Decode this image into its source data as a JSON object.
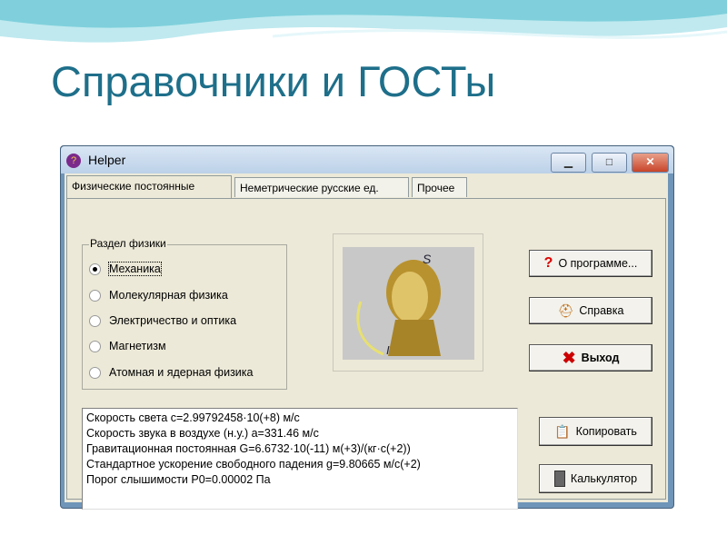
{
  "slide": {
    "title": "Справочники и ГОСТы"
  },
  "window": {
    "title": "Helper",
    "minimize": "▁",
    "maximize": "□",
    "close": "✕"
  },
  "tabs": [
    {
      "label": "Физические постоянные"
    },
    {
      "label": "Неметрические русские ед."
    },
    {
      "label": "Прочее"
    }
  ],
  "group": {
    "label": "Раздел физики",
    "options": [
      {
        "label": "Механика",
        "selected": true
      },
      {
        "label": "Молекулярная физика",
        "selected": false
      },
      {
        "label": "Электричество и оптика",
        "selected": false
      },
      {
        "label": "Магнетизм",
        "selected": false
      },
      {
        "label": "Атомная и ядерная физика",
        "selected": false
      }
    ]
  },
  "buttons": {
    "about": "О программе...",
    "help": "Справка",
    "exit": "Выход",
    "copy": "Копировать",
    "calc": "Калькулятор"
  },
  "memo": {
    "lines": [
      "Скорость света  c=2.99792458·10(+8) м/с",
      "Скорость звука в воздухе (н.у.)  a=331.46 м/с",
      "Гравитационная постоянная  G=6.6732·10(-11) м(+3)/(кг·с(+2))",
      "Стандартное ускорение свободного падения  g=9.80665 м/с(+2)",
      "Порог слышимости  P0=0.00002 Па"
    ]
  },
  "colors": {
    "title": "#1e6f8a",
    "wave": "#7fd0dc"
  }
}
